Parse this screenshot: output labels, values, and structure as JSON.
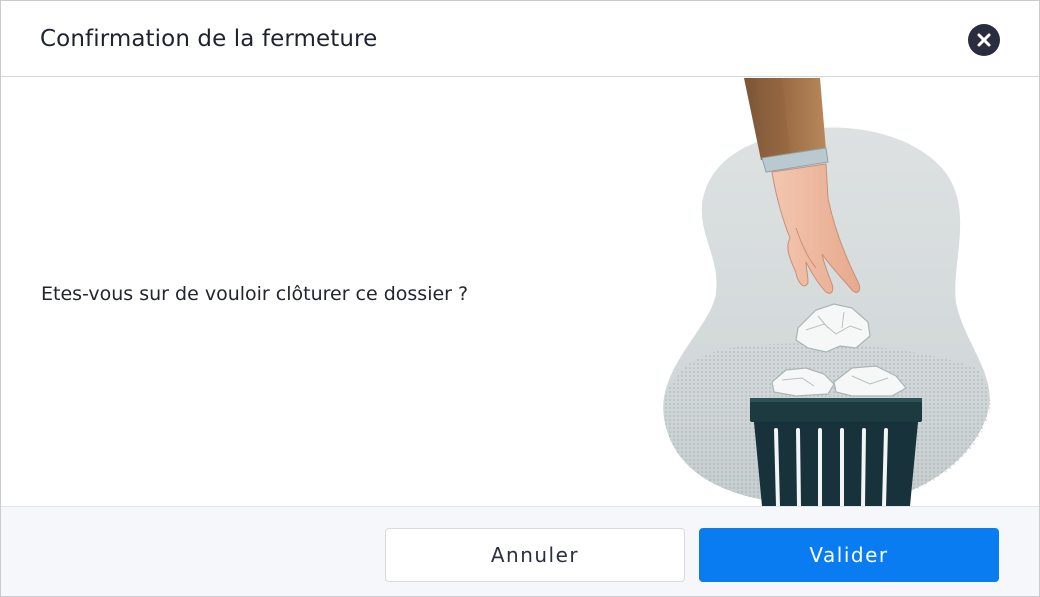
{
  "dialog": {
    "title": "Confirmation de la fermeture",
    "close_icon": "close-circle-icon",
    "message": "Etes-vous sur de vouloir clôturer ce dossier ?",
    "illustration": "hand-dropping-paper-into-trash-bin",
    "buttons": {
      "cancel_label": "Annuler",
      "confirm_label": "Valider"
    }
  },
  "colors": {
    "primary": "#0a7cf2",
    "close_button": "#2a2c40",
    "footer_background": "#f6f7fb",
    "text": "#23252f"
  }
}
